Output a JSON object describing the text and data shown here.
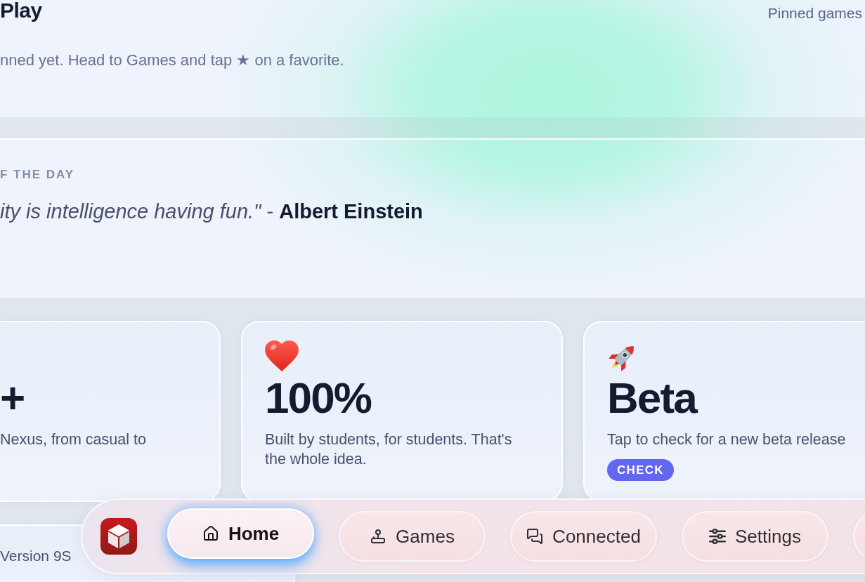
{
  "pinned_section": {
    "title": "Play",
    "side_note": "Pinned games",
    "empty_message": "nned yet. Head to Games and tap ★ on a favorite."
  },
  "quote_card": {
    "label": "F THE DAY",
    "quote": "*ity is intelligence having fun.\"* - **Albert Einstein**"
  },
  "stat_cards": [
    {
      "kind": "plain",
      "value": "+",
      "description": "Nexus, from casual to"
    },
    {
      "kind": "heart",
      "value": "100%",
      "description": "Built by students, for students. That's the whole idea."
    },
    {
      "kind": "rocket",
      "value": "Beta",
      "description": "Tap to check for a new beta release",
      "action": "CHECK"
    }
  ],
  "version_card": {
    "text": "Version 9S"
  },
  "nav": {
    "items": [
      {
        "kind": "home",
        "label": "Home",
        "selected": true
      },
      {
        "kind": "games",
        "label": "Games",
        "selected": false
      },
      {
        "kind": "chat",
        "label": "Connected",
        "selected": false
      },
      {
        "kind": "settings",
        "label": "Settings",
        "selected": false
      }
    ]
  }
}
